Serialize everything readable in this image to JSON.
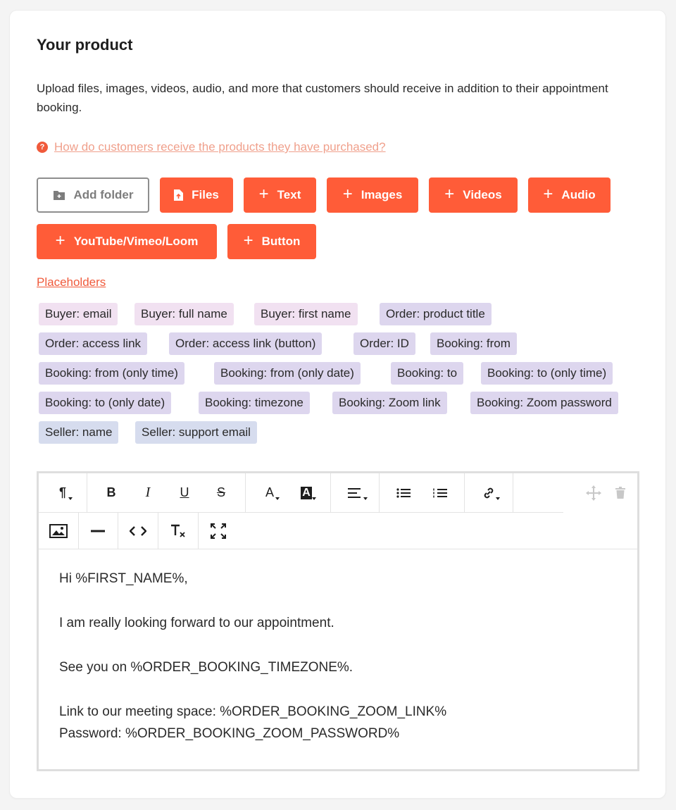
{
  "section": {
    "title": "Your product",
    "description": "Upload files, images, videos, audio, and more that customers should receive in addition to their appointment booking.",
    "help_link": "How do customers receive the products they have purchased?"
  },
  "buttons": {
    "add_folder": "Add folder",
    "files": "Files",
    "text": "Text",
    "images": "Images",
    "videos": "Videos",
    "audio": "Audio",
    "youtube": "YouTube/Vimeo/Loom",
    "button": "Button"
  },
  "placeholders": {
    "link": "Placeholders",
    "chips": [
      "Buyer: email",
      "Buyer: full name",
      "Buyer: first name",
      "Order: product title",
      "Order: access link",
      "Order: access link (button)",
      "Order: ID",
      "Booking: from",
      "Booking: from (only time)",
      "Booking: from (only date)",
      "Booking: to",
      "Booking: to (only time)",
      "Booking: to (only date)",
      "Booking: timezone",
      "Booking: Zoom link",
      "Booking: Zoom password",
      "Seller: name",
      "Seller: support email"
    ]
  },
  "editor": {
    "toolbar_icons": [
      "paragraph-icon",
      "bold-icon",
      "italic-icon",
      "underline-icon",
      "strikethrough-icon",
      "text-color-icon",
      "background-color-icon",
      "align-icon",
      "bulleted-list-icon",
      "numbered-list-icon",
      "link-icon",
      "move-icon",
      "trash-icon",
      "image-icon",
      "horizontal-line-icon",
      "code-view-icon",
      "clear-format-icon",
      "fullscreen-icon"
    ],
    "lines": [
      "Hi %FIRST_NAME%,",
      "I am really looking forward to our appointment.",
      "See you on %ORDER_BOOKING_TIMEZONE%.",
      "Link to our meeting space: %ORDER_BOOKING_ZOOM_LINK%",
      "Password: %ORDER_BOOKING_ZOOM_PASSWORD%"
    ]
  },
  "colors": {
    "accent": "#ff5c38",
    "link": "#f05a3b",
    "chip_buyer": "#f1e1f1",
    "chip_order_booking": "#ddd6ee",
    "chip_seller": "#d6dcee"
  }
}
